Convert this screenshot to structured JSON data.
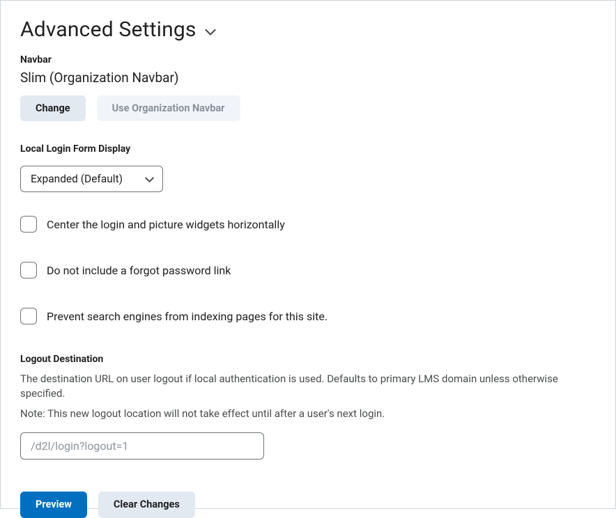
{
  "heading": "Advanced Settings",
  "navbar": {
    "label": "Navbar",
    "value": "Slim (Organization Navbar)",
    "change_label": "Change",
    "use_org_label": "Use Organization Navbar"
  },
  "login_form": {
    "label": "Local Login Form Display",
    "selected": "Expanded (Default)"
  },
  "checkboxes": {
    "center_widgets": "Center the login and picture widgets horizontally",
    "no_forgot_link": "Do not include a forgot password link",
    "prevent_index": "Prevent search engines from indexing pages for this site."
  },
  "logout": {
    "label": "Logout Destination",
    "description": "The destination URL on user logout if local authentication is used. Defaults to primary LMS domain unless otherwise specified.",
    "note": "Note: This new logout location will not take effect until after a user's next login.",
    "placeholder": "/d2l/login?logout=1"
  },
  "footer": {
    "preview": "Preview",
    "clear": "Clear Changes"
  }
}
